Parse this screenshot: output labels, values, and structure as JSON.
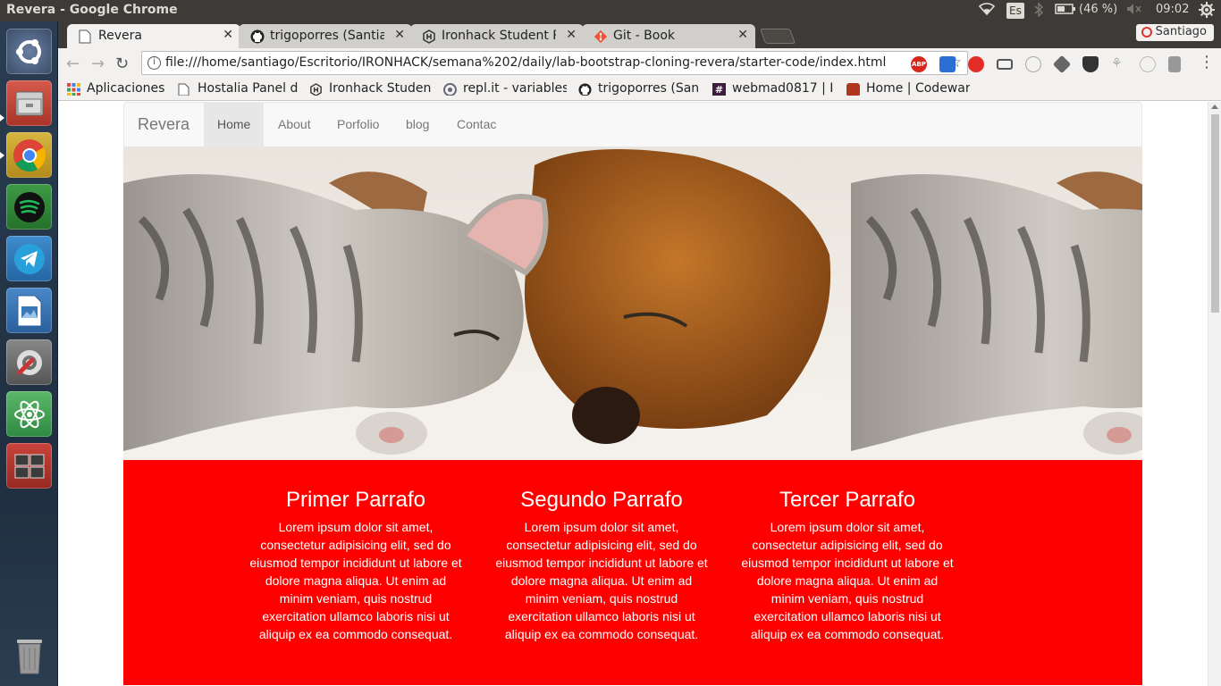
{
  "window": {
    "title": "Revera - Google Chrome",
    "keyboard": "Es",
    "battery": "(46 %)",
    "time": "09:02"
  },
  "launcher": {
    "apps": [
      "ubuntu-dash",
      "files",
      "chrome",
      "spotify",
      "telegram",
      "libreoffice-impress",
      "system-settings",
      "atom",
      "workspace-switcher",
      "trash"
    ]
  },
  "tabs": [
    {
      "label": "Revera",
      "icon": "page-icon",
      "active": true
    },
    {
      "label": "trigoporres (Santia",
      "icon": "github-icon"
    },
    {
      "label": "Ironhack Student P",
      "icon": "ironhack-icon"
    },
    {
      "label": "Git - Book",
      "icon": "git-icon"
    }
  ],
  "profile": "Santiago",
  "address": "file:///home/santiago/Escritorio/IRONHACK/semana%202/daily/lab-bootstrap-cloning-revera/starter-code/index.html",
  "bookmarks": [
    {
      "label": "Aplicaciones",
      "icon": "apps-grid-icon"
    },
    {
      "label": "Hostalia Panel d",
      "icon": "page-icon"
    },
    {
      "label": "Ironhack Studen",
      "icon": "ironhack-icon"
    },
    {
      "label": "repl.it - variables",
      "icon": "replit-icon"
    },
    {
      "label": "trigoporres (San",
      "icon": "github-icon"
    },
    {
      "label": "webmad0817 | Ir",
      "icon": "slack-icon"
    },
    {
      "label": "Home | Codewar",
      "icon": "codewars-icon"
    }
  ],
  "site": {
    "brand": "Revera",
    "nav": [
      "Home",
      "About",
      "Porfolio",
      "blog",
      "Contac"
    ],
    "active_nav": "Home",
    "accent": "#ff0000",
    "columns": [
      {
        "title": "Primer Parrafo",
        "text": "Lorem ipsum dolor sit amet, consectetur adipisicing elit, sed do eiusmod tempor incididunt ut labore et dolore magna aliqua. Ut enim ad minim veniam, quis nostrud exercitation ullamco laboris nisi ut aliquip ex ea commodo consequat."
      },
      {
        "title": "Segundo Parrafo",
        "text": "Lorem ipsum dolor sit amet, consectetur adipisicing elit, sed do eiusmod tempor incididunt ut labore et dolore magna aliqua. Ut enim ad minim veniam, quis nostrud exercitation ullamco laboris nisi ut aliquip ex ea commodo consequat."
      },
      {
        "title": "Tercer Parrafo",
        "text": "Lorem ipsum dolor sit amet, consectetur adipisicing elit, sed do eiusmod tempor incididunt ut labore et dolore magna aliqua. Ut enim ad minim veniam, quis nostrud exercitation ullamco laboris nisi ut aliquip ex ea commodo consequat."
      }
    ]
  }
}
